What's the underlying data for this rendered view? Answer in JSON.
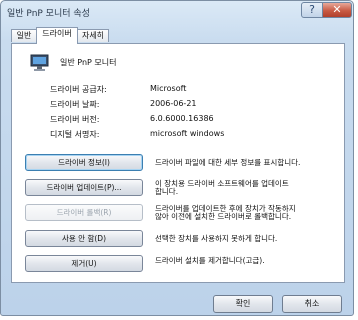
{
  "window": {
    "title": "일반 PnP 모니터 속성",
    "help_glyph": "?",
    "close_glyph": "✕"
  },
  "tabs": [
    {
      "label": "일반"
    },
    {
      "label": "드라이버"
    },
    {
      "label": "자세히"
    }
  ],
  "device": {
    "name": "일반 PnP 모니터",
    "icon": "monitor-icon"
  },
  "driver_info": [
    {
      "label": "드라이버 공급자:",
      "value": "Microsoft"
    },
    {
      "label": "드라이버 날짜:",
      "value": "2006-06-21"
    },
    {
      "label": "드라이버 버전:",
      "value": "6.0.6000.16386"
    },
    {
      "label": "디지털 서명자:",
      "value": "microsoft windows"
    }
  ],
  "actions": [
    {
      "label": "드라이버 정보(I)",
      "description": "드라이버 파일에 대한 세부 정보를 표시합니다."
    },
    {
      "label": "드라이버 업데이트(P)...",
      "description": "이 장치용 드라이버 소프트웨어를 업데이트\n합니다."
    },
    {
      "label": "드라이버 롤백(R)",
      "description": "드라이버를 업데이트한 후에 장치가 작동하지\n않아 이전에 설치한 드라이버로 롤백합니다."
    },
    {
      "label": "사용 안 함(D)",
      "description": "선택한 장치를 사용하지 못하게 합니다."
    },
    {
      "label": "제거(U)",
      "description": "드라이버 설치를 제거합니다(고급)."
    }
  ],
  "footer": {
    "ok_label": "확인",
    "cancel_label": "취소"
  },
  "colors": {
    "title_gradient": "#c9dcef",
    "close_button": "#c85a43",
    "focus_border": "#3c7fb1"
  }
}
